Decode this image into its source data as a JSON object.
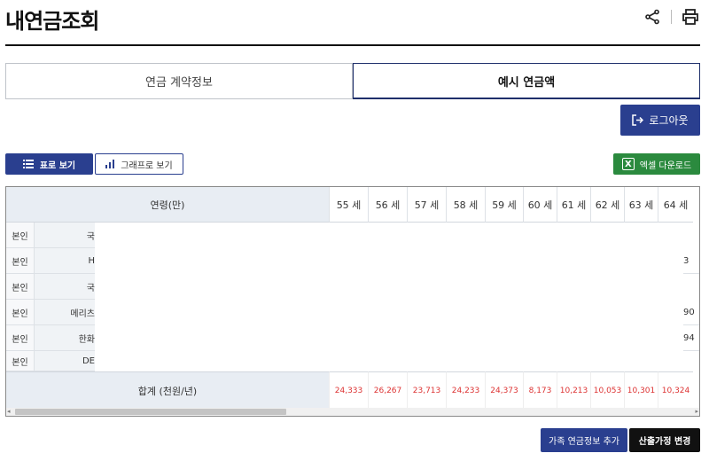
{
  "header": {
    "title": "내연금조회",
    "share_icon": "share-icon",
    "print_icon": "print-icon"
  },
  "tabs": [
    {
      "label": "연금 계약정보",
      "active": false
    },
    {
      "label": "예시 연금액",
      "active": true
    }
  ],
  "logout": {
    "label": "로그아웃",
    "icon": "logout-icon"
  },
  "view_toggle": {
    "table_label": "표로 보기",
    "graph_label": "그래프로 보기"
  },
  "excel": {
    "label": "엑셀 다운로드",
    "icon_text": "X"
  },
  "table": {
    "left_header": "연령(만)",
    "ages": [
      "55 세",
      "56 세",
      "57 세",
      "58 세",
      "59 세",
      "60 세",
      "61 세",
      "62 세",
      "63 세",
      "64 세"
    ],
    "rows": [
      {
        "who": "본인",
        "product": "국",
        "tail": ""
      },
      {
        "who": "본인",
        "product": "H",
        "tail": "3"
      },
      {
        "who": "본인",
        "product": "국",
        "tail": ""
      },
      {
        "who": "본인",
        "product": "메리츠",
        "tail": "90"
      },
      {
        "who": "본인",
        "product": "한화",
        "tail": "94"
      },
      {
        "who": "본인",
        "product": "DE",
        "tail": ""
      }
    ],
    "sum_label": "합계 (천원/년)",
    "sum_values": [
      "24,333",
      "26,267",
      "23,713",
      "24,233",
      "24,373",
      "8,173",
      "10,213",
      "10,053",
      "10,301",
      "10,324"
    ]
  },
  "bottom": {
    "add_label": "가족 연금정보 추가",
    "change_label": "산출가정 변경"
  },
  "colors": {
    "navy": "#2a3f8f",
    "excel_green": "#2b8a3e",
    "sum_red": "#d33"
  }
}
